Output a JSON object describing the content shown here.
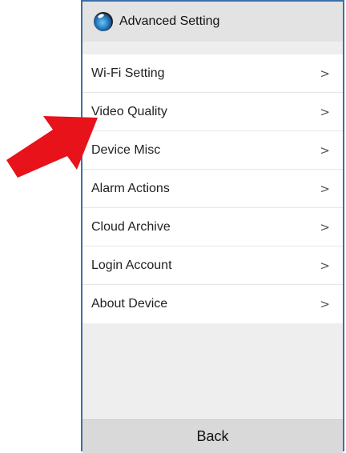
{
  "header": {
    "title": "Advanced Setting",
    "icon": "camera-eye-icon"
  },
  "menu": {
    "items": [
      {
        "label": "Wi-Fi Setting",
        "chevron": ">"
      },
      {
        "label": "Video Quality",
        "chevron": ">"
      },
      {
        "label": "Device Misc",
        "chevron": ">"
      },
      {
        "label": "Alarm Actions",
        "chevron": ">"
      },
      {
        "label": "Cloud Archive",
        "chevron": ">"
      },
      {
        "label": "Login Account",
        "chevron": ">"
      },
      {
        "label": "About Device",
        "chevron": ">"
      }
    ]
  },
  "footer": {
    "back_label": "Back"
  },
  "annotation": {
    "arrow_color": "#e8121a",
    "points_to": "Video Quality"
  },
  "colors": {
    "frame_border": "#3d6fa8"
  }
}
